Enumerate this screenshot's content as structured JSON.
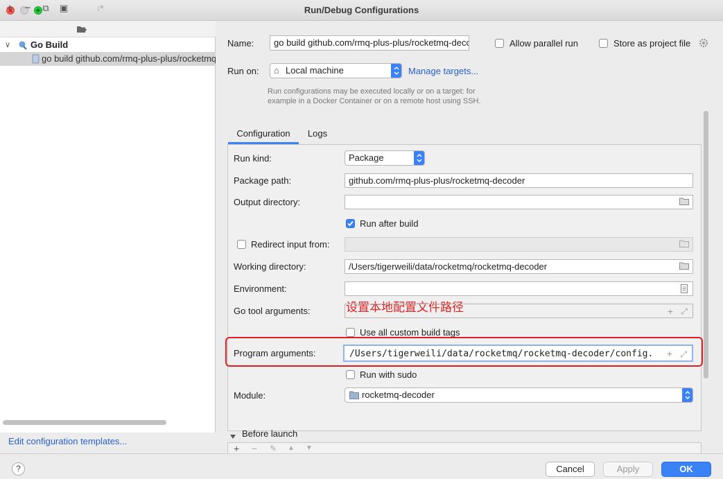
{
  "window": {
    "title": "Run/Debug Configurations"
  },
  "toolbar": {
    "add": "+",
    "remove": "−",
    "copy": "⧉",
    "save": "▣",
    "folder": "▸",
    "sort": "↓ª"
  },
  "tree": {
    "group_label": "Go Build",
    "item_label": "go build github.com/rmq-plus-plus/rocketmq-decoder"
  },
  "left_footer": {
    "edit_templates": "Edit configuration templates..."
  },
  "form": {
    "name_label": "Name:",
    "name_value": "go build github.com/rmq-plus-plus/rocketmq-decoder",
    "allow_parallel": "Allow parallel run",
    "store_project": "Store as project file",
    "run_on_label": "Run on:",
    "run_on_value": "Local machine",
    "manage_targets": "Manage targets...",
    "run_on_hint_1": "Run configurations may be executed locally or on a target: for",
    "run_on_hint_2": "example in a Docker Container or on a remote host using SSH."
  },
  "tabs": [
    {
      "label": "Configuration"
    },
    {
      "label": "Logs"
    }
  ],
  "config": {
    "run_kind_label": "Run kind:",
    "run_kind_value": "Package",
    "package_path_label": "Package path:",
    "package_path_value": "github.com/rmq-plus-plus/rocketmq-decoder",
    "output_dir_label": "Output directory:",
    "output_dir_value": "",
    "run_after_build": "Run after build",
    "redirect_input": "Redirect input from:",
    "working_dir_label": "Working directory:",
    "working_dir_value": "/Users/tigerweili/data/rocketmq/rocketmq-decoder",
    "environment_label": "Environment:",
    "environment_value": "",
    "go_tool_args_label": "Go tool arguments:",
    "go_tool_args_value": "",
    "use_custom_tags": "Use all custom build tags",
    "program_args_label": "Program arguments:",
    "program_args_value": "/Users/tigerweili/data/rocketmq/rocketmq-decoder/config.",
    "run_with_sudo": "Run with sudo",
    "module_label": "Module:",
    "module_value": "rocketmq-decoder"
  },
  "annotation": {
    "text": "设置本地配置文件路径"
  },
  "before_launch": {
    "label": "Before launch"
  },
  "buttons": {
    "help": "?",
    "cancel": "Cancel",
    "apply": "Apply",
    "ok": "OK"
  },
  "colors": {
    "accent": "#3a82f6",
    "annotation": "#e02020",
    "link": "#2860c8"
  }
}
